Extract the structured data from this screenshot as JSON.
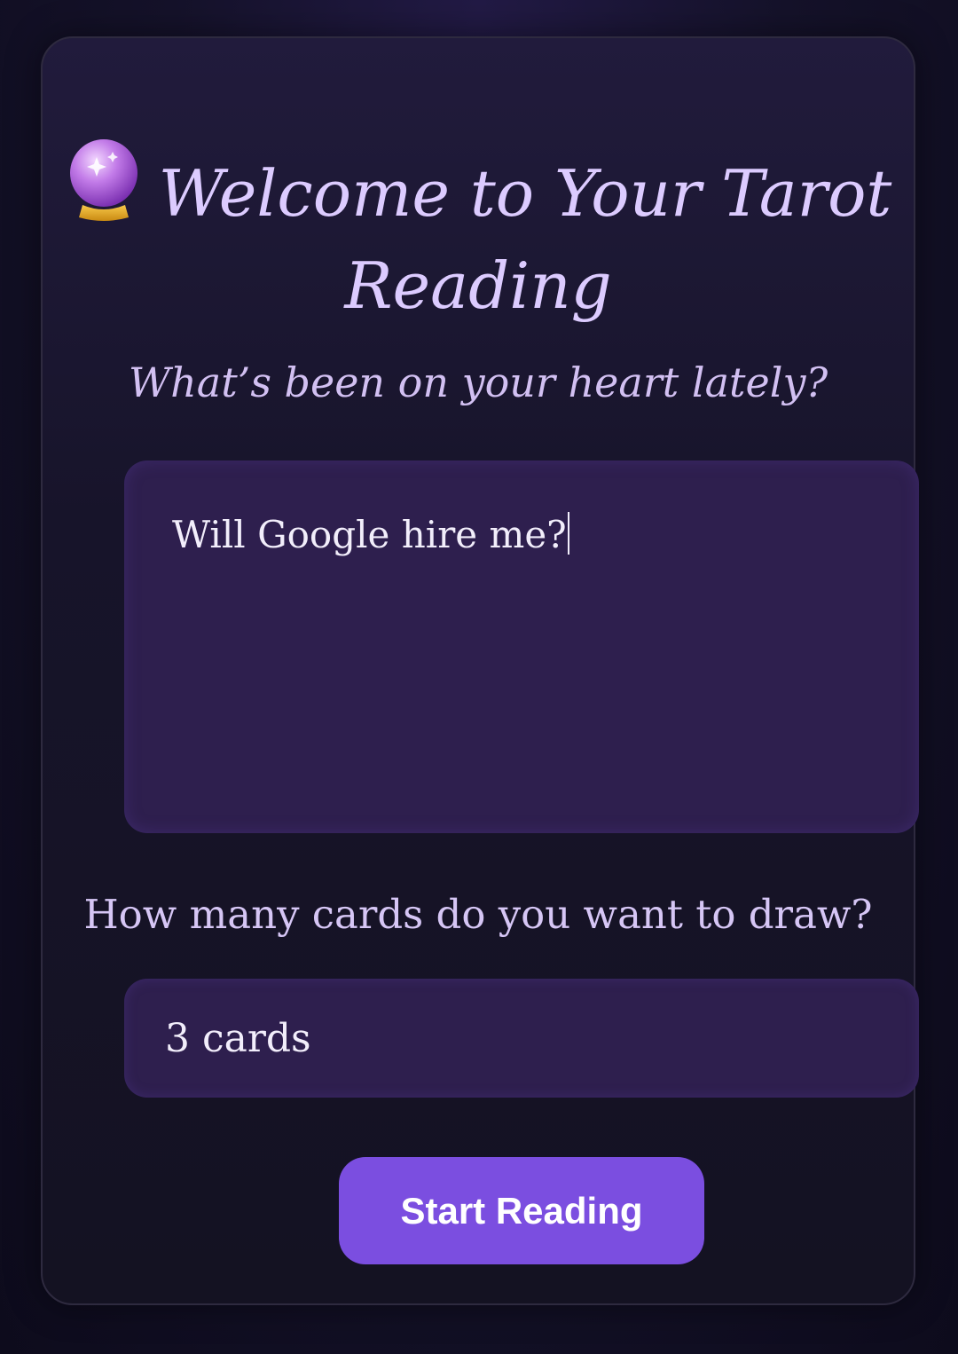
{
  "header": {
    "title_line1": "Welcome to Your Tarot",
    "title_line2": "Reading",
    "icon": "crystal-ball-icon"
  },
  "question": {
    "prompt": "What’s been on your heart lately?",
    "value": "Will Google hire me?"
  },
  "cards": {
    "label": "How many cards do you want to draw?",
    "selected": "3 cards"
  },
  "actions": {
    "start_label": "Start Reading"
  },
  "colors": {
    "accent": "#7b4ee0",
    "title": "#dccbff",
    "field_bg": "#2e1f4e"
  }
}
